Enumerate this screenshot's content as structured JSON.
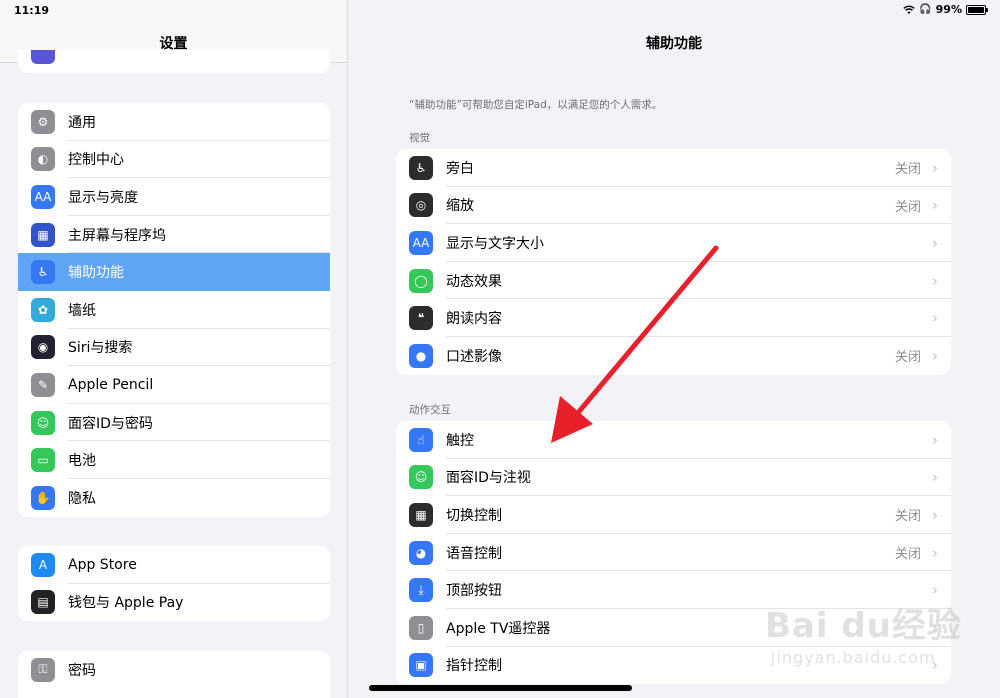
{
  "status_bar": {
    "time": "11:19",
    "battery_percent": "99%",
    "battery_level": 0.99
  },
  "sidebar": {
    "title": "设置",
    "groups": [
      {
        "items": [
          {
            "label": "通用",
            "icon": "gear-icon",
            "color": "#8e8e93"
          },
          {
            "label": "控制中心",
            "icon": "toggles-icon",
            "color": "#8e8e93"
          },
          {
            "label": "显示与亮度",
            "icon": "text-size-icon",
            "color": "#3478f6"
          },
          {
            "label": "主屏幕与程序坞",
            "icon": "home-grid-icon",
            "color": "#3354c8"
          },
          {
            "label": "辅助功能",
            "icon": "accessibility-icon",
            "color": "#3478f6",
            "selected": true
          },
          {
            "label": "墙纸",
            "icon": "flower-icon",
            "color": "#34aadc"
          },
          {
            "label": "Siri与搜索",
            "icon": "siri-icon",
            "color": "#222233"
          },
          {
            "label": "Apple Pencil",
            "icon": "pencil-icon",
            "color": "#8e8e93"
          },
          {
            "label": "面容ID与密码",
            "icon": "face-id-icon",
            "color": "#34c759"
          },
          {
            "label": "电池",
            "icon": "battery-icon",
            "color": "#34c759"
          },
          {
            "label": "隐私",
            "icon": "hand-icon",
            "color": "#3478f6"
          }
        ]
      },
      {
        "items": [
          {
            "label": "App Store",
            "icon": "app-store-icon",
            "color": "#1c8cf4"
          },
          {
            "label": "钱包与 Apple Pay",
            "icon": "wallet-icon",
            "color": "#222222"
          }
        ]
      },
      {
        "items": [
          {
            "label": "密码",
            "icon": "key-icon",
            "color": "#8e8e93"
          }
        ]
      }
    ]
  },
  "main": {
    "title": "辅助功能",
    "description": "“辅助功能”可帮助您自定iPad，以满足您的个人需求。",
    "sections": [
      {
        "header": "视觉",
        "items": [
          {
            "label": "旁白",
            "value": "关闭",
            "icon": "voiceover-icon",
            "color": "#2c2c2e"
          },
          {
            "label": "缩放",
            "value": "关闭",
            "icon": "zoom-icon",
            "color": "#2c2c2e"
          },
          {
            "label": "显示与文字大小",
            "value": "",
            "icon": "text-size-icon",
            "color": "#3478f6"
          },
          {
            "label": "动态效果",
            "value": "",
            "icon": "motion-icon",
            "color": "#34c759"
          },
          {
            "label": "朗读内容",
            "value": "",
            "icon": "speech-bubble-icon",
            "color": "#2c2c2e"
          },
          {
            "label": "口述影像",
            "value": "关闭",
            "icon": "audio-description-icon",
            "color": "#3478f6"
          }
        ]
      },
      {
        "header": "动作交互",
        "items": [
          {
            "label": "触控",
            "value": "",
            "icon": "touch-hand-icon",
            "color": "#3478f6"
          },
          {
            "label": "面容ID与注视",
            "value": "",
            "icon": "face-id-icon",
            "color": "#34c759"
          },
          {
            "label": "切换控制",
            "value": "关闭",
            "icon": "switch-grid-icon",
            "color": "#2c2c2e"
          },
          {
            "label": "语音控制",
            "value": "关闭",
            "icon": "voice-control-icon",
            "color": "#3478f6"
          },
          {
            "label": "顶部按钮",
            "value": "",
            "icon": "top-button-icon",
            "color": "#3478f6"
          },
          {
            "label": "Apple TV遥控器",
            "value": "",
            "icon": "tv-remote-icon",
            "color": "#8e8e93"
          },
          {
            "label": "指针控制",
            "value": "",
            "icon": "pointer-icon",
            "color": "#3478f6"
          }
        ]
      }
    ]
  },
  "watermark": {
    "brand": "Bai du经验",
    "url": "jingyan.baidu.com"
  },
  "annotation": {
    "arrow_color": "#e8202a"
  }
}
